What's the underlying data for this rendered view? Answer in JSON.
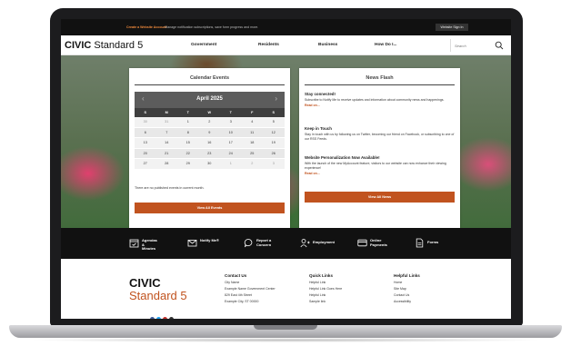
{
  "topbar": {
    "create_account": "Create a Website Account",
    "manage_text": "- Manage notification subscriptions, save form progress and more.",
    "signin": "Website Sign In"
  },
  "header": {
    "logo_bold": "CIVIC",
    "logo_light": "Standard 5",
    "nav": [
      "Government",
      "Residents",
      "Business",
      "How Do I..."
    ],
    "search_placeholder": "Search"
  },
  "calendar": {
    "title": "Calendar Events",
    "month": "April 2025",
    "days_of_week": [
      "S",
      "M",
      "T",
      "W",
      "T",
      "F",
      "S"
    ],
    "weeks": [
      [
        "30",
        "31",
        "1",
        "2",
        "3",
        "4",
        "5"
      ],
      [
        "6",
        "7",
        "8",
        "9",
        "10",
        "11",
        "12"
      ],
      [
        "13",
        "14",
        "15",
        "16",
        "17",
        "18",
        "19"
      ],
      [
        "20",
        "21",
        "22",
        "23",
        "24",
        "25",
        "26"
      ],
      [
        "27",
        "28",
        "29",
        "30",
        "1",
        "2",
        "3"
      ]
    ],
    "note": "There are no published events in current month.",
    "button": "View All Events"
  },
  "news": {
    "title": "News Flash",
    "items": [
      {
        "heading": "Stay connected!",
        "body": "Subscribe to Notify Me to receive updates and information about community news and happenings.",
        "more": "Read on..."
      },
      {
        "heading": "Keep in Touch",
        "body": "Stay in touch with us by following us on Twitter, becoming our friend on Facebook, or subscribing to one of our RSS Feeds.",
        "more": "Read on..."
      },
      {
        "heading": "Website Personalization Now Available!",
        "body": "With the launch of the new MyAccount feature, visitors to our website can now enhance their viewing experience!",
        "more": "Read on..."
      }
    ],
    "button": "View All News"
  },
  "quicklinks": [
    {
      "label": "Agendas & Minutes",
      "icon": "calendar-check-icon"
    },
    {
      "label": "Notify Me®",
      "icon": "envelope-icon"
    },
    {
      "label": "Report a Concern",
      "icon": "chat-bubble-icon"
    },
    {
      "label": "Employment",
      "icon": "user-plus-icon"
    },
    {
      "label": "Online Payments",
      "icon": "credit-card-icon"
    },
    {
      "label": "Forms",
      "icon": "document-icon"
    }
  ],
  "footer": {
    "logo_bold": "CIVIC",
    "logo_light": "Standard 5",
    "contact": {
      "title": "Contact Us",
      "lines": [
        "City Name",
        "Example Name Government Center",
        "829 East 4th Street",
        "Example City, ST 00000"
      ]
    },
    "quick": {
      "title": "Quick Links",
      "lines": [
        "Helpful Link",
        "Helpful Link Goes Here",
        "Helpful Link",
        "Sample link"
      ]
    },
    "helpful": {
      "title": "Helpful Links",
      "lines": [
        "Home",
        "Site Map",
        "Contact Us",
        "Accessibility"
      ]
    },
    "social_colors": [
      "#3b5998",
      "#1da1f2",
      "#c4302b",
      "#333333"
    ]
  }
}
